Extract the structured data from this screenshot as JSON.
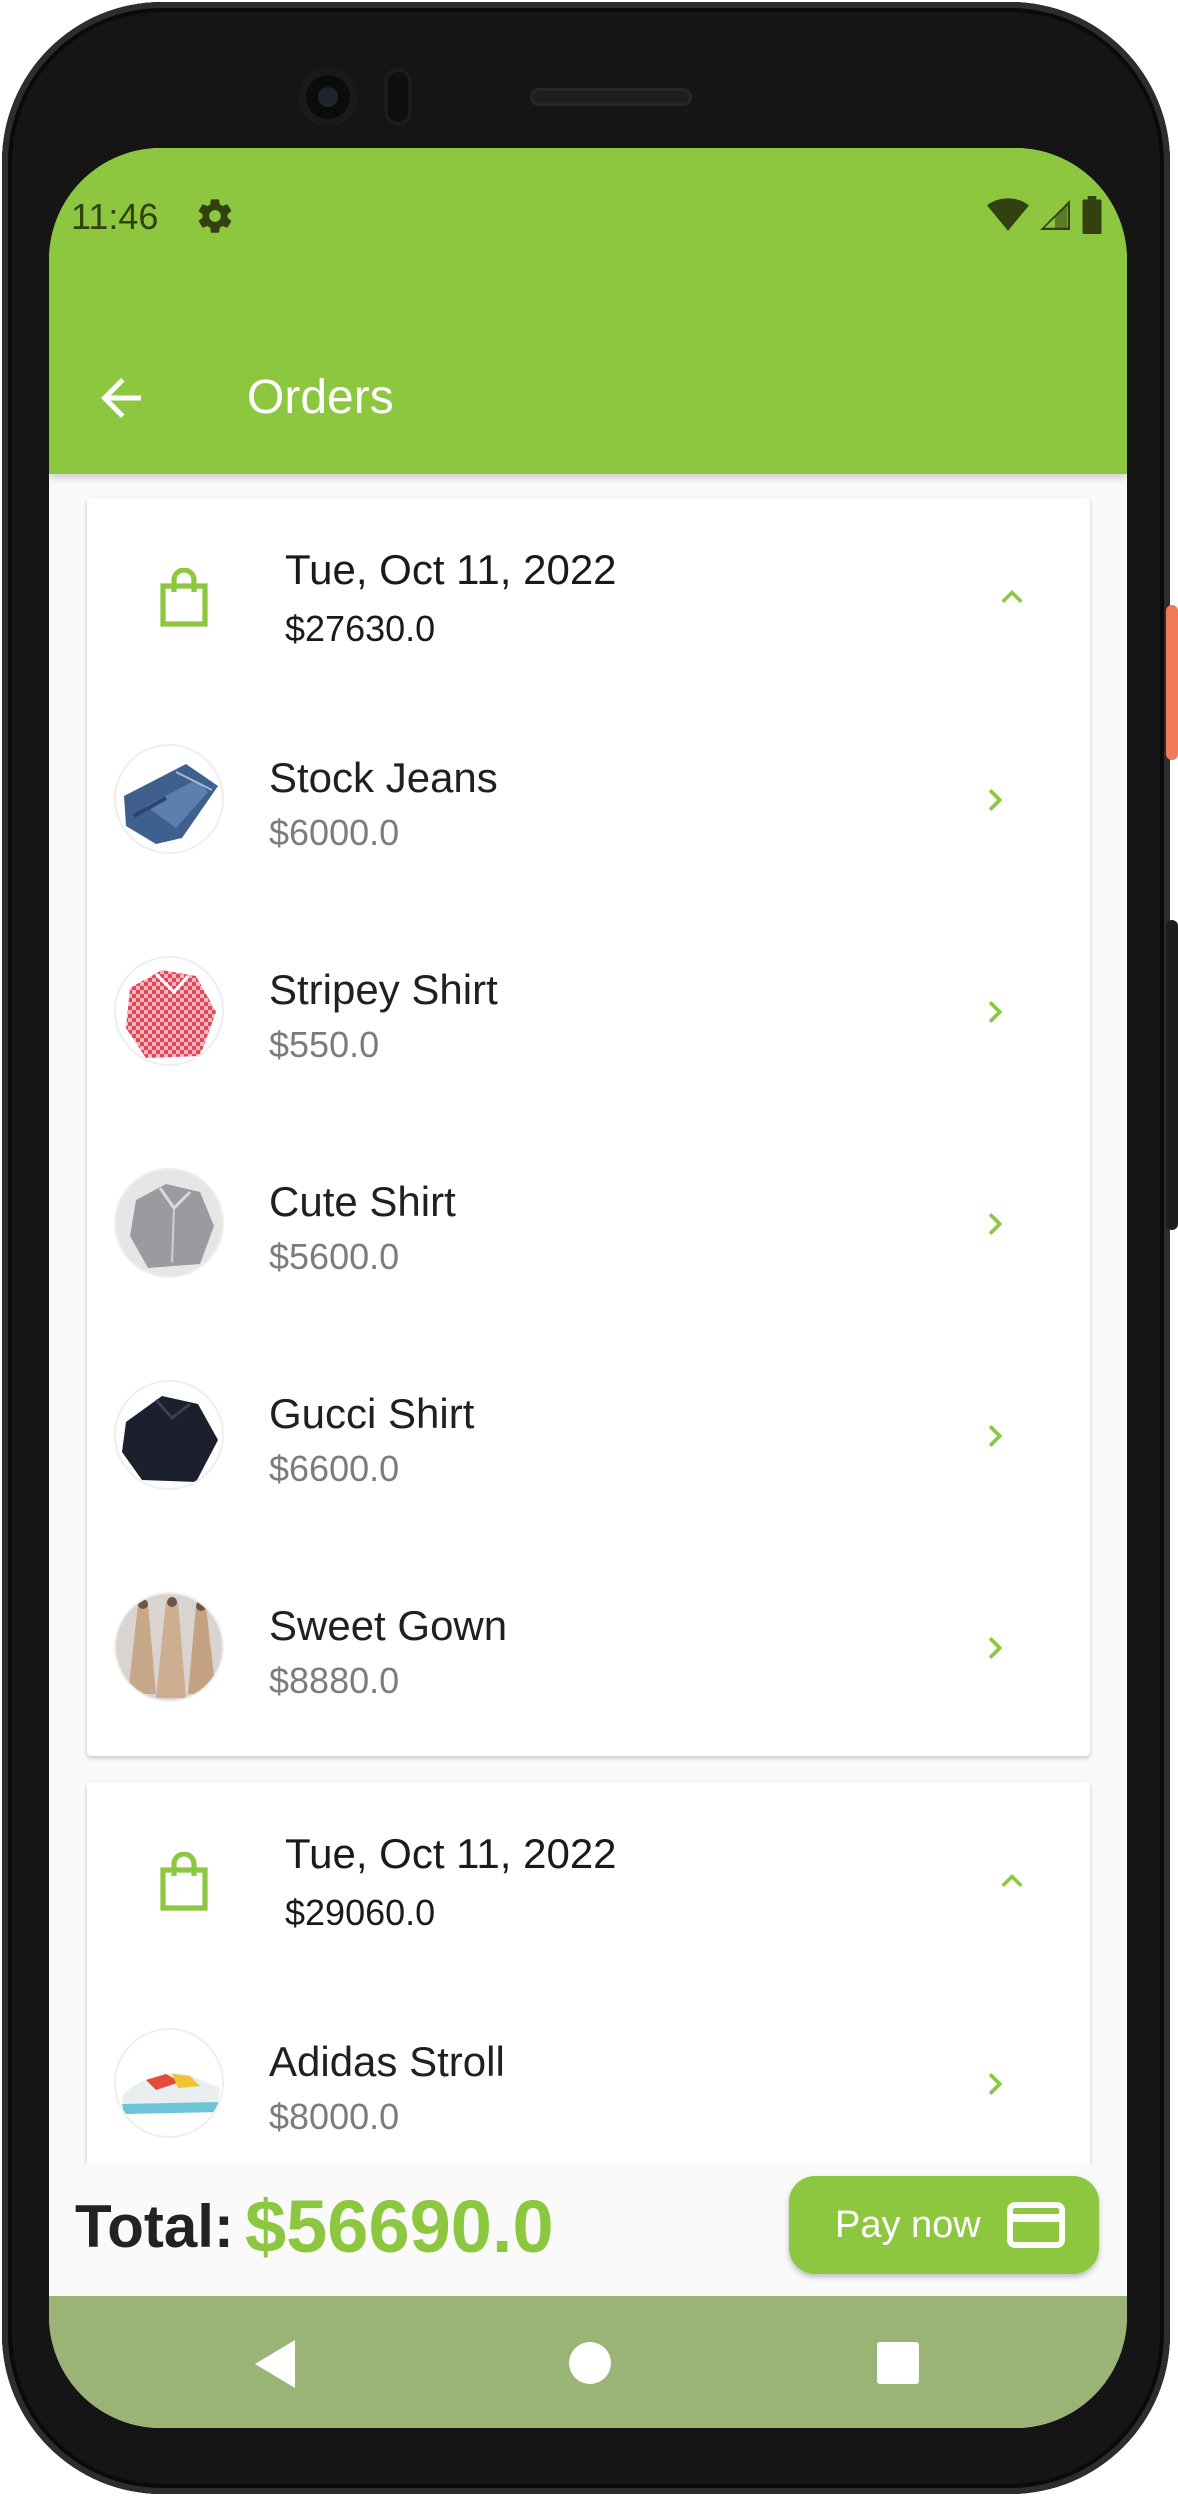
{
  "status_bar": {
    "time": "11:46",
    "icons": [
      "gear-icon",
      "wifi-icon",
      "cell-signal-icon",
      "battery-icon"
    ]
  },
  "app_bar": {
    "title": "Orders",
    "back_icon": "arrow-left-icon"
  },
  "orders": [
    {
      "date": "Tue, Oct 11, 2022",
      "total": "$27630.0",
      "expanded": true,
      "items": [
        {
          "name": "Stock Jeans",
          "price": "$6000.0",
          "image": "jeans"
        },
        {
          "name": "Stripey Shirt",
          "price": "$550.0",
          "image": "red-shirt"
        },
        {
          "name": "Cute Shirt",
          "price": "$5600.0",
          "image": "grey-shirt"
        },
        {
          "name": "Gucci Shirt",
          "price": "$6600.0",
          "image": "black-shirt"
        },
        {
          "name": "Sweet Gown",
          "price": "$8880.0",
          "image": "gown"
        }
      ]
    },
    {
      "date": "Tue, Oct 11, 2022",
      "total": "$29060.0",
      "expanded": true,
      "items": [
        {
          "name": "Adidas Stroll",
          "price": "$8000.0",
          "image": "sneaker"
        }
      ]
    }
  ],
  "footer": {
    "total_label": "Total:",
    "total_value": "$56690.0",
    "pay_label": "Pay now"
  },
  "colors": {
    "accent": "#8dc63f",
    "nav_bar": "#99b474",
    "background": "#fafafa"
  }
}
